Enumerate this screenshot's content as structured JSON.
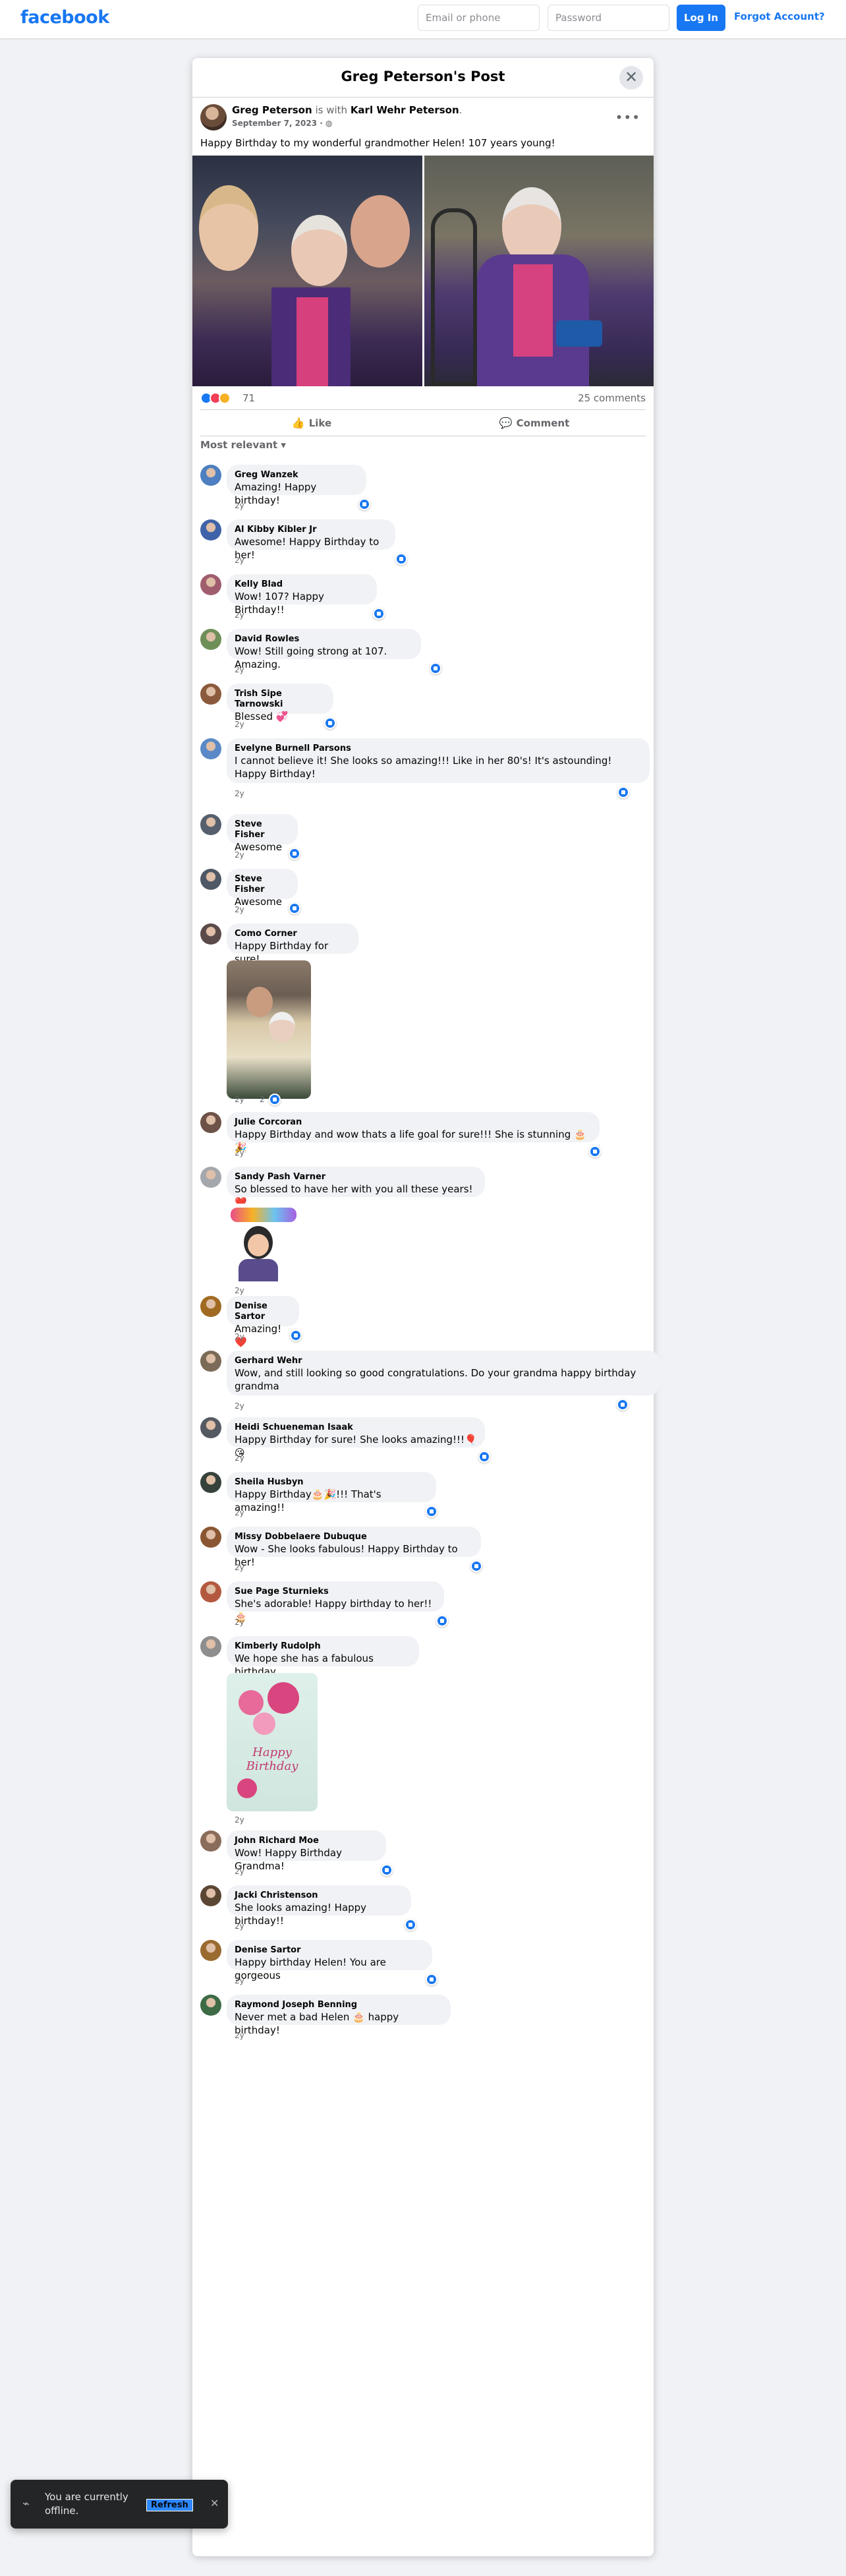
{
  "topbar": {
    "brand": "facebook",
    "email_placeholder": "Email or phone",
    "password_placeholder": "Password",
    "login_label": "Log In",
    "forgot_label": "Forgot Account?",
    "brand_color": "#1877f2"
  },
  "post": {
    "dialog_title": "Greg Peterson's Post",
    "author": "Greg Peterson",
    "with_text": "is with",
    "tagged": "Karl Wehr Peterson",
    "date": "September 7, 2023",
    "privacy_icon": "globe-icon",
    "text": "Happy Birthday to my wonderful grandmother Helen! 107 years young!",
    "reaction_count": "71",
    "comment_count": "25 comments",
    "like_label": "Like",
    "comment_label": "Comment",
    "sort_label": "Most relevant"
  },
  "comments": [
    {
      "name": "Greg Wanzek",
      "text": "Amazing! Happy birthday!",
      "time": "2y"
    },
    {
      "name": "Al Kibby Kibler Jr",
      "text": "Awesome! Happy Birthday to her!",
      "time": "2y"
    },
    {
      "name": "Kelly Blad",
      "text": "Wow! 107? Happy Birthday!!",
      "time": "2y"
    },
    {
      "name": "David Rowles",
      "text": "Wow! Still going strong at 107. Amazing.",
      "time": "2y"
    },
    {
      "name": "Trish Sipe Tarnowski",
      "text": "Blessed 💞",
      "time": "2y"
    },
    {
      "name": "Evelyne Burnell Parsons",
      "text": "I cannot believe it! She looks so amazing!!! Like in her 80's! It's astounding! Happy Birthday!",
      "time": "2y"
    },
    {
      "name": "Steve Fisher",
      "text": "Awesome",
      "time": "2y"
    },
    {
      "name": "Steve Fisher",
      "text": "Awesome",
      "time": "2y"
    },
    {
      "name": "Como Corner",
      "text": "Happy Birthday for sure!",
      "time": "2y",
      "like_count": "2"
    },
    {
      "name": "Julie Corcoran",
      "text": "Happy Birthday and wow thats a life goal for sure!!! She is stunning 🎂🎉",
      "time": "2y"
    },
    {
      "name": "Sandy Pash Varner",
      "text": "So blessed to have her with you all these years!❤️",
      "time": "2y"
    },
    {
      "name": "Denise Sartor",
      "text": "Amazing! ❤️",
      "time": "2y"
    },
    {
      "name": "Gerhard Wehr",
      "text": "Wow, and still looking so good congratulations. Do your grandma happy birthday grandma",
      "time": "2y"
    },
    {
      "name": "Heidi Schueneman Isaak",
      "text": "Happy Birthday for sure! She looks amazing!!!🎈😘",
      "time": "2y"
    },
    {
      "name": "Sheila Husbyn",
      "text": "Happy Birthday🎂🎉!!! That's amazing!!",
      "time": "2y"
    },
    {
      "name": "Missy Dobbelaere Dubuque",
      "text": "Wow - She looks fabulous! Happy Birthday to her!",
      "time": "2y"
    },
    {
      "name": "Sue Page Sturnieks",
      "text": "She's adorable! Happy birthday to her!!🎂",
      "time": "2y"
    },
    {
      "name": "Kimberly Rudolph",
      "text": "We hope she has a fabulous birthday",
      "time": "2y"
    },
    {
      "name": "John Richard Moe",
      "text": "Wow! Happy Birthday Grandma!",
      "time": "2y"
    },
    {
      "name": "Jacki Christenson",
      "text": "She looks amazing! Happy birthday!!",
      "time": "2y"
    },
    {
      "name": "Denise Sartor",
      "text": "Happy birthday Helen! You are gorgeous",
      "time": "2y"
    },
    {
      "name": "Raymond Joseph Benning",
      "text": "Never met a bad Helen 🎂 happy birthday!",
      "time": "2y"
    }
  ],
  "stickers": {
    "happy_birthday_card": "Happy Birthday"
  },
  "toast": {
    "message": "You are currently offline.",
    "refresh_label": "Refresh",
    "icon": "wifi-off-icon"
  }
}
